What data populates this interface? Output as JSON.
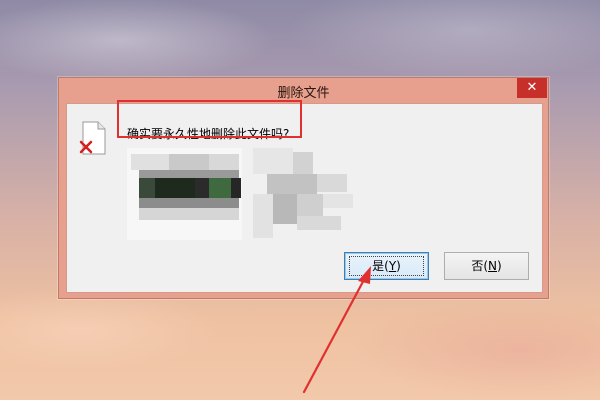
{
  "dialog": {
    "title": "删除文件",
    "close_label": "✕",
    "message": "确实要永久性地删除此文件吗?",
    "yes_label": "是(",
    "yes_key": "Y",
    "yes_close": ")",
    "no_label": "否(",
    "no_key": "N",
    "no_close": ")"
  },
  "icons": {
    "file": "file-delete-icon",
    "close": "close-icon"
  },
  "colors": {
    "title_bar": "#e7a08d",
    "close_button": "#c7302a",
    "client_bg": "#f0f0f0",
    "annotation_red": "#e03030",
    "default_button_border": "#3c7fb1"
  }
}
